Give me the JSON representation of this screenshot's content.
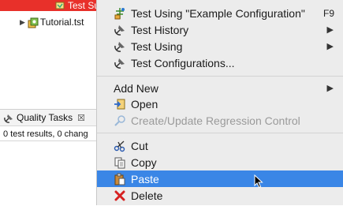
{
  "tree": {
    "selected_label": "Test Su",
    "tutorial_label": "Tutorial.tst"
  },
  "quality_tasks": {
    "tab_label": "Quality Tasks",
    "close_glyph": "☒",
    "status_text": "0 test results, 0 chang"
  },
  "menu": {
    "items": [
      {
        "label": "Test Using \"Example Configuration\"",
        "shortcut": "F9",
        "icon": "run-config-icon"
      },
      {
        "label": "Test History",
        "submenu": true,
        "icon": "satellite-icon"
      },
      {
        "label": "Test Using",
        "submenu": true,
        "icon": "satellite-icon"
      },
      {
        "label": "Test Configurations...",
        "icon": "satellite-icon"
      },
      {
        "label": "Add New",
        "submenu": true
      },
      {
        "label": "Open",
        "icon": "open-icon"
      },
      {
        "label": "Create/Update Regression Control",
        "disabled": true,
        "icon": "regression-icon"
      },
      {
        "label": "Cut",
        "icon": "scissors-icon"
      },
      {
        "label": "Copy",
        "icon": "copy-icon"
      },
      {
        "label": "Paste",
        "highlighted": true,
        "icon": "paste-icon"
      },
      {
        "label": "Delete",
        "icon": "delete-icon"
      }
    ]
  },
  "colors": {
    "selection_red": "#e8302a",
    "menu_highlight": "#3a86e6",
    "delete_red": "#d62020"
  }
}
